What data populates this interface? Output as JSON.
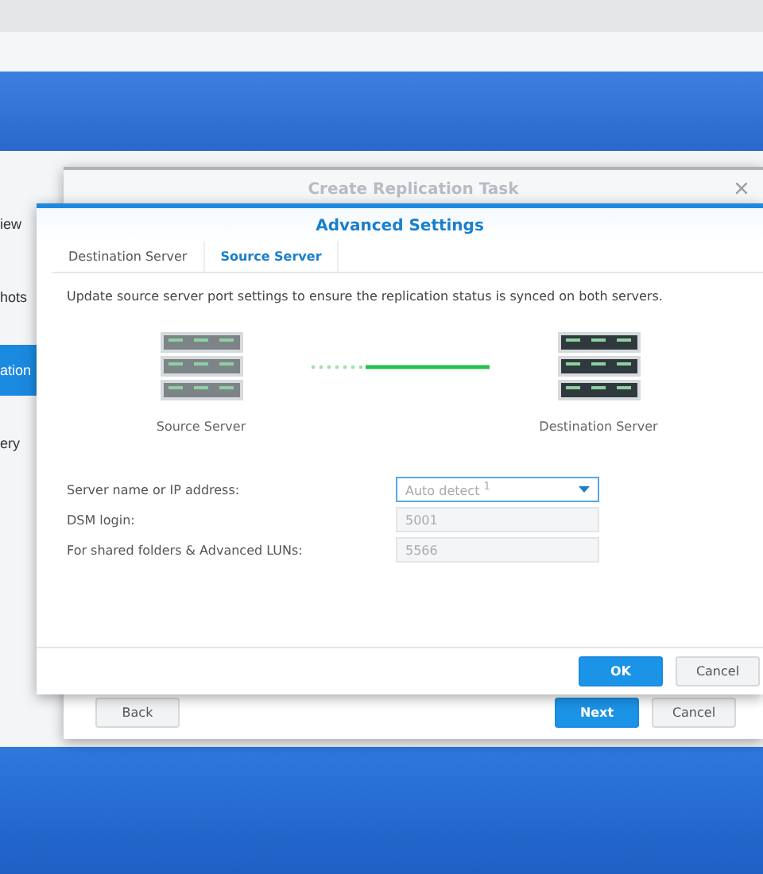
{
  "app": {
    "sidebar": [
      {
        "label": "iew",
        "selected": false
      },
      {
        "label": "hots",
        "selected": false
      },
      {
        "label": "ation",
        "selected": true
      },
      {
        "label": "ery",
        "selected": false
      }
    ]
  },
  "back_window": {
    "title": "Create Replication Task",
    "buttons": [
      {
        "label": "Back",
        "kind": "default"
      },
      {
        "label": "Next",
        "kind": "primary"
      },
      {
        "label": "Cancel",
        "kind": "default"
      }
    ]
  },
  "dialog": {
    "title": "Advanced Settings",
    "tabs": [
      {
        "label": "Destination Server",
        "selected": false
      },
      {
        "label": "Source Server",
        "selected": true
      }
    ],
    "description": "Update source server port settings to ensure the replication status is synced on both servers.",
    "diagram": {
      "source_label": "Source Server",
      "destination_label": "Destination Server"
    },
    "fields": [
      {
        "label": "Server name or IP address:",
        "kind": "dropdown",
        "value": "Auto detect $^{1}$",
        "disabled": false
      },
      {
        "label": "DSM login:",
        "kind": "text",
        "value": "5001",
        "disabled": true
      },
      {
        "label": "For shared folders & Advanced LUNs:",
        "kind": "text",
        "value": "5566",
        "disabled": true
      }
    ],
    "buttons": [
      {
        "label": "OK",
        "kind": "primary"
      },
      {
        "label": "Cancel",
        "kind": "default"
      }
    ]
  }
}
